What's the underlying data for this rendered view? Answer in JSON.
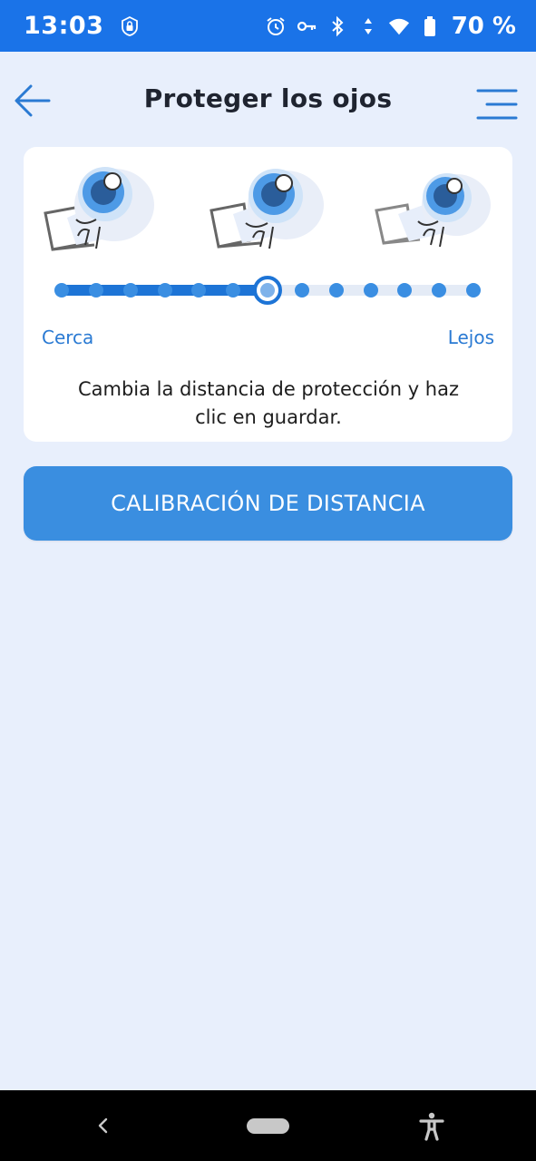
{
  "status_bar": {
    "time": "13:03",
    "battery_percent": "70 %",
    "icons": [
      "lock-badge-icon",
      "alarm-icon",
      "vpn-key-icon",
      "bluetooth-icon",
      "data-arrows-icon",
      "wifi-icon",
      "battery-icon"
    ]
  },
  "header": {
    "title": "Proteger los ojos",
    "back_icon": "arrow-left-icon",
    "menu_icon": "menu-icon"
  },
  "distance_card": {
    "illustrations": [
      "eye-laptop-near",
      "eye-laptop-medium",
      "eye-laptop-far"
    ],
    "slider": {
      "steps": 13,
      "selected_index": 6
    },
    "label_near": "Cerca",
    "label_far": "Lejos",
    "instruction_line1": "Cambia la distancia de protección y haz",
    "instruction_line2": "clic en guardar."
  },
  "calibration_button": {
    "label": "CALIBRACIÓN DE DISTANCIA"
  },
  "nav_bar": {
    "icons": [
      "back-icon",
      "home-pill-icon",
      "accessibility-icon"
    ]
  },
  "colors": {
    "status_bar": "#1a73e8",
    "background": "#e8effc",
    "accent": "#1d74d6",
    "button": "#3a8ee0"
  }
}
